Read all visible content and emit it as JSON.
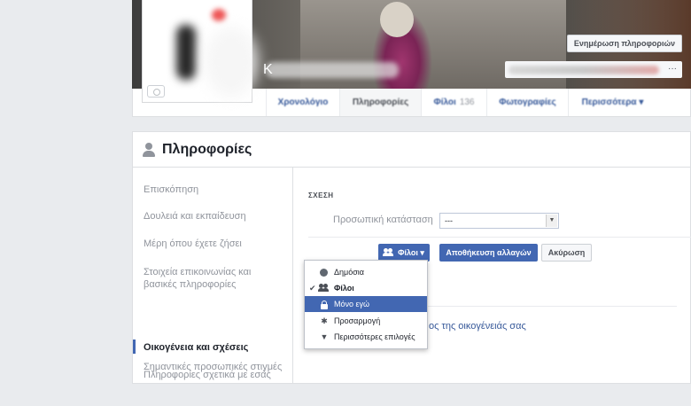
{
  "header": {
    "update_info_button": "Ενημέρωση πληροφοριών",
    "more_dots": "···",
    "name_initial": "K"
  },
  "tabs": [
    {
      "label": "Χρονολόγιο"
    },
    {
      "label": "Πληροφορίες"
    },
    {
      "label": "Φίλοι",
      "count": "136"
    },
    {
      "label": "Φωτογραφίες"
    },
    {
      "label": "Περισσότερα ▾"
    }
  ],
  "panel": {
    "title": "Πληροφορίες",
    "nav": [
      {
        "label": "Επισκόπηση"
      },
      {
        "label": "Δουλειά και εκπαίδευση"
      },
      {
        "label": "Μέρη όπου έχετε ζήσει"
      },
      {
        "label": "Στοιχεία επικοινωνίας και βασικές πληροφορίες"
      },
      {
        "label": "Οικογένεια και σχέσεις"
      },
      {
        "label": "Πληροφορίες σχετικά με εσάς"
      },
      {
        "label": "Σημαντικές προσωπικές στιγμές"
      }
    ]
  },
  "relationship": {
    "section_label": "ΣΧΕΣΗ",
    "status_label": "Προσωπική κατάσταση",
    "status_value": "---",
    "audience_button": "Φίλοι ▾",
    "save_button": "Αποθήκευση αλλαγών",
    "cancel_button": "Ακύρωση",
    "family_link": "ος της οικογένειάς σας"
  },
  "audience_menu": {
    "items": [
      {
        "label": "Δημόσια",
        "icon": "globe-icon"
      },
      {
        "label": "Φίλοι",
        "icon": "friends-icon",
        "checked": true
      },
      {
        "label": "Μόνο εγώ",
        "icon": "lock-icon",
        "highlighted": true
      },
      {
        "label": "Προσαρμογή",
        "icon": "gear-icon"
      },
      {
        "label": "Περισσότερες επιλογές",
        "icon": "triangle-down-icon"
      }
    ]
  },
  "colors": {
    "brand_blue": "#4267b2",
    "link_blue": "#365899",
    "page_bg": "#e9ebee"
  }
}
